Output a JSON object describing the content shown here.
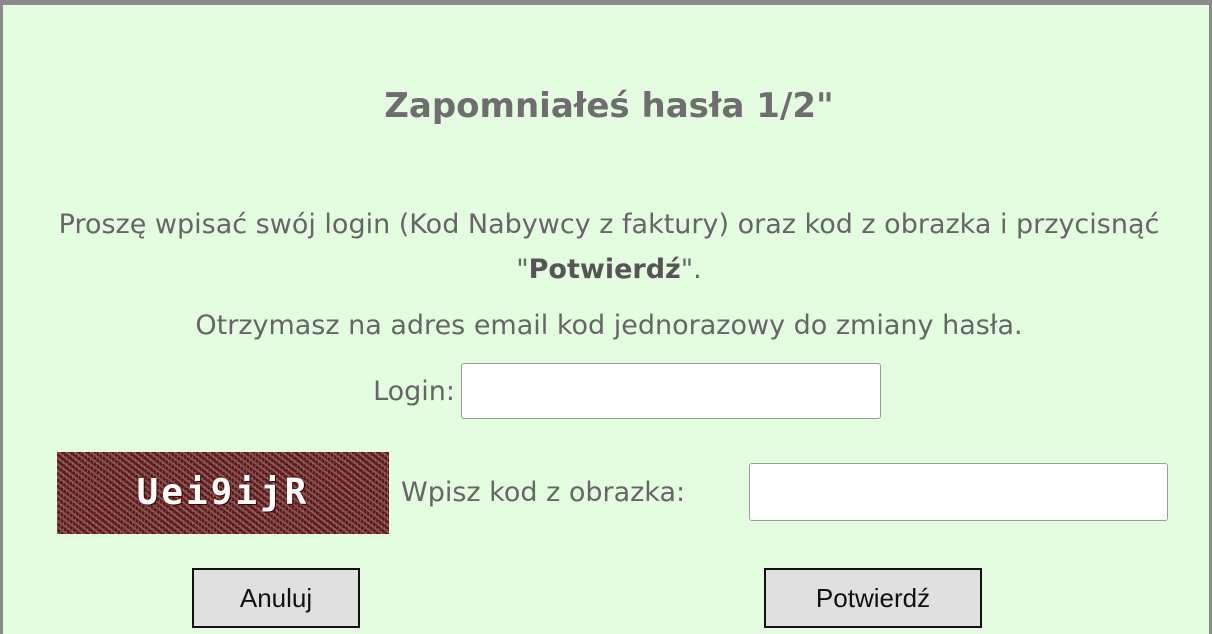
{
  "form": {
    "title": "Zapomniałeś hasła 1/2\"",
    "instruction_before": "Proszę wpisać swój login (Kod Nabywcy z faktury) oraz kod z obrazka i przycisnąć \"",
    "instruction_bold": "Potwierdź",
    "instruction_after": "\".",
    "info": "Otrzymasz na adres email kod jednorazowy do zmiany hasła.",
    "login_label": "Login:",
    "login_value": "",
    "captcha_text": "Uei9ijR",
    "code_label": "Wpisz kod z obrazka:",
    "code_value": "",
    "cancel_label": "Anuluj",
    "confirm_label": "Potwierdź"
  },
  "colors": {
    "panel_background": "#e4fde1",
    "border": "#8a8a8a",
    "text": "#666666",
    "button_background": "#e0e0e0",
    "captcha_background": "#5d2a2a"
  }
}
